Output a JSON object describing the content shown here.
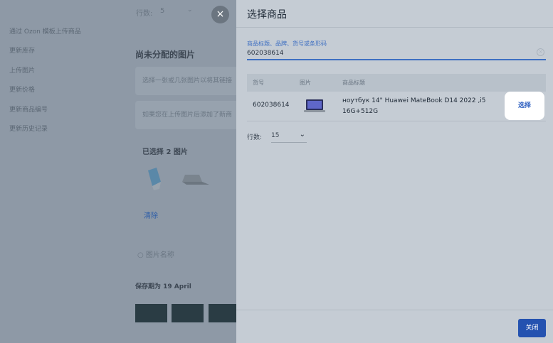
{
  "background": {
    "sidebar_items": [
      "通过 Ozon 模板上传商品",
      "更新库存",
      "上传图片",
      "更新价格",
      "更新商品编号",
      "更新历史记录"
    ],
    "rows_label": "行数:",
    "rows_value": "5",
    "unassigned_title": "尚未分配的图片",
    "hint_select": "选择一张或几张图片以将其链接",
    "hint_upload": "如果您在上传图片后添加了新商",
    "selected_count": "已选择 2 图片",
    "clear_label": "清除",
    "search_placeholder": "图片名称",
    "saved_label": "保存期为 19 April"
  },
  "dialog": {
    "title": "选择商品",
    "search_label": "商品标题、品牌、货号或条形码",
    "search_value": "602038614",
    "columns": [
      "货号",
      "图片",
      "商品标题"
    ],
    "rows": [
      {
        "sku": "602038614",
        "title": "ноутбук 14\" Huawei MateBook D14 2022 ,i5 16G+512G",
        "action": "选择"
      }
    ],
    "rows_label": "行数:",
    "rows_value": "15",
    "close_label": "关闭"
  }
}
